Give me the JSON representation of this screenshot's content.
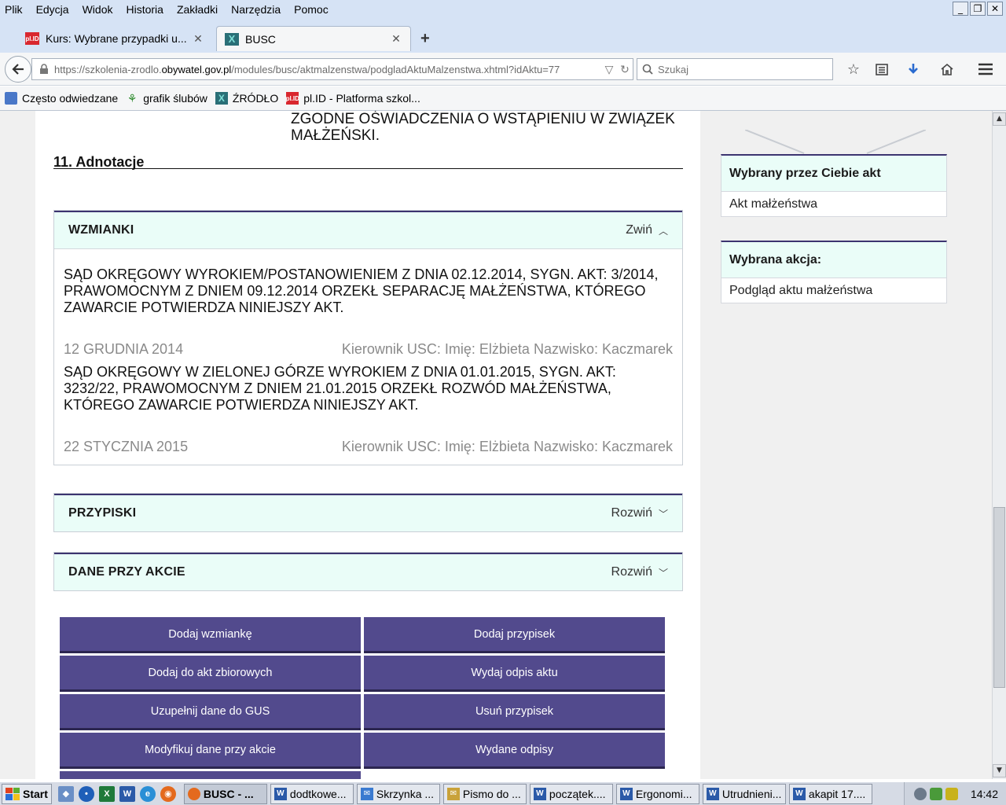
{
  "menubar": {
    "items": [
      "Plik",
      "Edycja",
      "Widok",
      "Historia",
      "Zakładki",
      "Narzędzia",
      "Pomoc"
    ]
  },
  "tabs": [
    {
      "title": "Kurs: Wybrane przypadki u...",
      "favicon": "pl.ID"
    },
    {
      "title": "BUSC",
      "favicon": "X"
    }
  ],
  "navbar": {
    "url_prefix": "https://szkolenia-zrodlo.",
    "url_domain": "obywatel.gov.pl",
    "url_path": "/modules/busc/aktmalzenstwa/podgladAktuMalzenstwa.xhtml?idAktu=77",
    "search_placeholder": "Szukaj"
  },
  "bookmarks": [
    {
      "label": "Często odwiedzane",
      "icon": "folder-icon"
    },
    {
      "label": "grafik ślubów",
      "icon": "tree-icon"
    },
    {
      "label": "ŹRÓDŁO",
      "icon": "zrodlo-icon"
    },
    {
      "label": "pl.ID - Platforma szkol...",
      "icon": "plid-icon"
    }
  ],
  "page": {
    "consent_text": "ZGODNE OŚWIADCZENIA O WSTĄPIENIU W ZWIĄZEK MAŁŻEŃSKI.",
    "section_title": "11. Adnotacje",
    "wzmianki": {
      "title": "WZMIANKI",
      "toggle": "Zwiń",
      "notes": [
        {
          "text": "SĄD OKRĘGOWY WYROKIEM/POSTANOWIENIEM Z DNIA 02.12.2014, SYGN. AKT: 3/2014, PRAWOMOCNYM Z DNIEM 09.12.2014 ORZEKŁ SEPARACJĘ MAŁŻEŃSTWA, KTÓREGO ZAWARCIE POTWIERDZA NINIEJSZY AKT.",
          "date": "12 GRUDNIA 2014",
          "signer": "Kierownik USC: Imię: Elżbieta Nazwisko: Kaczmarek"
        },
        {
          "text": "SĄD OKRĘGOWY W ZIELONEJ GÓRZE WYROKIEM Z DNIA 01.01.2015, SYGN. AKT: 3232/22, PRAWOMOCNYM Z DNIEM 21.01.2015 ORZEKŁ ROZWÓD MAŁŻEŃSTWA, KTÓREGO ZAWARCIE POTWIERDZA NINIEJSZY AKT.",
          "date": "22 STYCZNIA 2015",
          "signer": "Kierownik USC: Imię: Elżbieta Nazwisko: Kaczmarek"
        }
      ]
    },
    "przypiski": {
      "title": "PRZYPISKI",
      "toggle": "Rozwiń"
    },
    "dane": {
      "title": "DANE PRZY AKCIE",
      "toggle": "Rozwiń"
    },
    "actions": [
      "Dodaj wzmiankę",
      "Dodaj przypisek",
      "Dodaj do akt zbiorowych",
      "Wydaj odpis aktu",
      "Uzupełnij dane do GUS",
      "Usuń przypisek",
      "Modyfikuj dane przy akcie",
      "Wydane odpisy"
    ]
  },
  "sidebar": {
    "selected_act": {
      "heading": "Wybrany przez Ciebie akt",
      "value": "Akt małżeństwa"
    },
    "selected_action": {
      "heading": "Wybrana akcja:",
      "value": "Podgląd aktu małżeństwa"
    }
  },
  "taskbar": {
    "start": "Start",
    "tasks": [
      "BUSC - ...",
      "dodtkowe...",
      "Skrzynka ...",
      "Pismo do ...",
      "początek....",
      "Ergonomi...",
      "Utrudnieni...",
      "akapit 17...."
    ],
    "clock": "14:42"
  },
  "colors": {
    "accent": "#524a8d",
    "header_bg": "#eafdf8",
    "border_accent": "#3c3470"
  }
}
